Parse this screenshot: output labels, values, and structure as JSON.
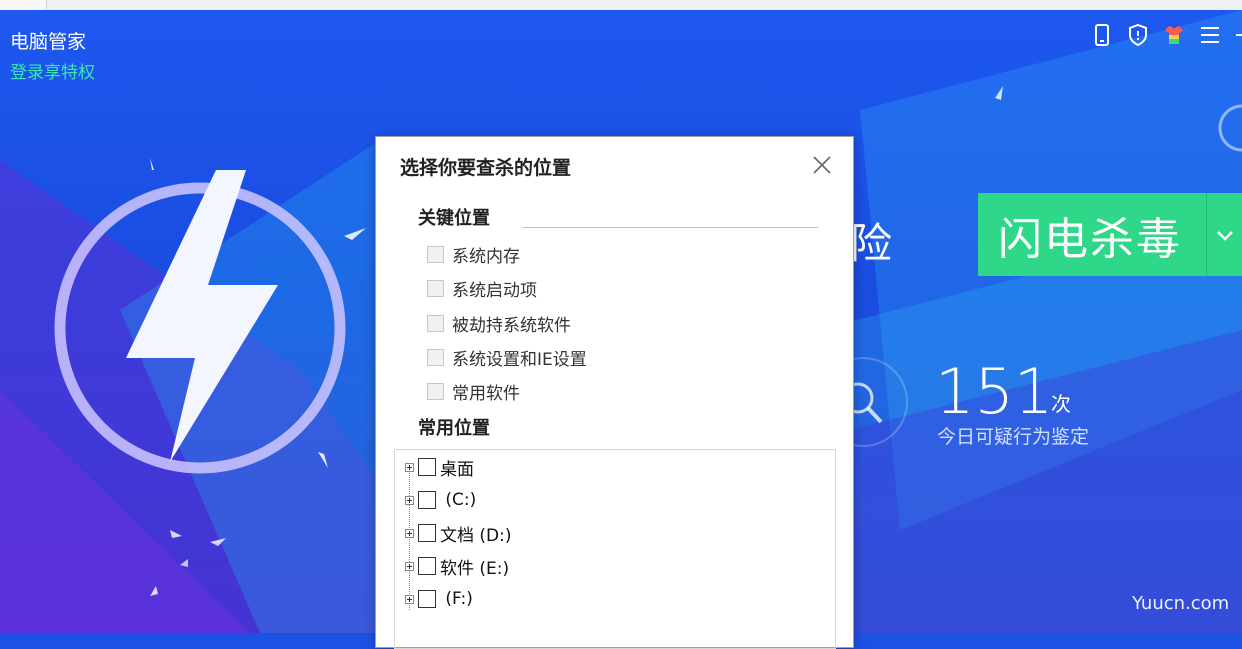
{
  "app": {
    "title": "电脑管家",
    "login_label": "登录享特权",
    "toolbar_icons": [
      "phone-icon",
      "shield-icon",
      "shirt-icon",
      "menu-icon"
    ],
    "colors": {
      "accent_green": "#2ed888",
      "login_teal": "#38e6b6",
      "bg_blue": "#1c52e3"
    }
  },
  "main": {
    "partial_text": "险",
    "flash_button_label": "闪电杀毒",
    "count_value": "151",
    "count_unit": "次",
    "count_label": "今日可疑行为鉴定"
  },
  "dialog": {
    "title": "选择你要查杀的位置",
    "key_section": "关键位置",
    "key_items": [
      "系统内存",
      "系统启动项",
      "被劫持系统软件",
      "系统设置和IE设置",
      "常用软件"
    ],
    "common_section": "常用位置",
    "tree_items": [
      "桌面",
      " (C:)",
      "文档 (D:)",
      "软件 (E:)",
      " (F:)"
    ]
  },
  "watermark": "Yuucn.com"
}
